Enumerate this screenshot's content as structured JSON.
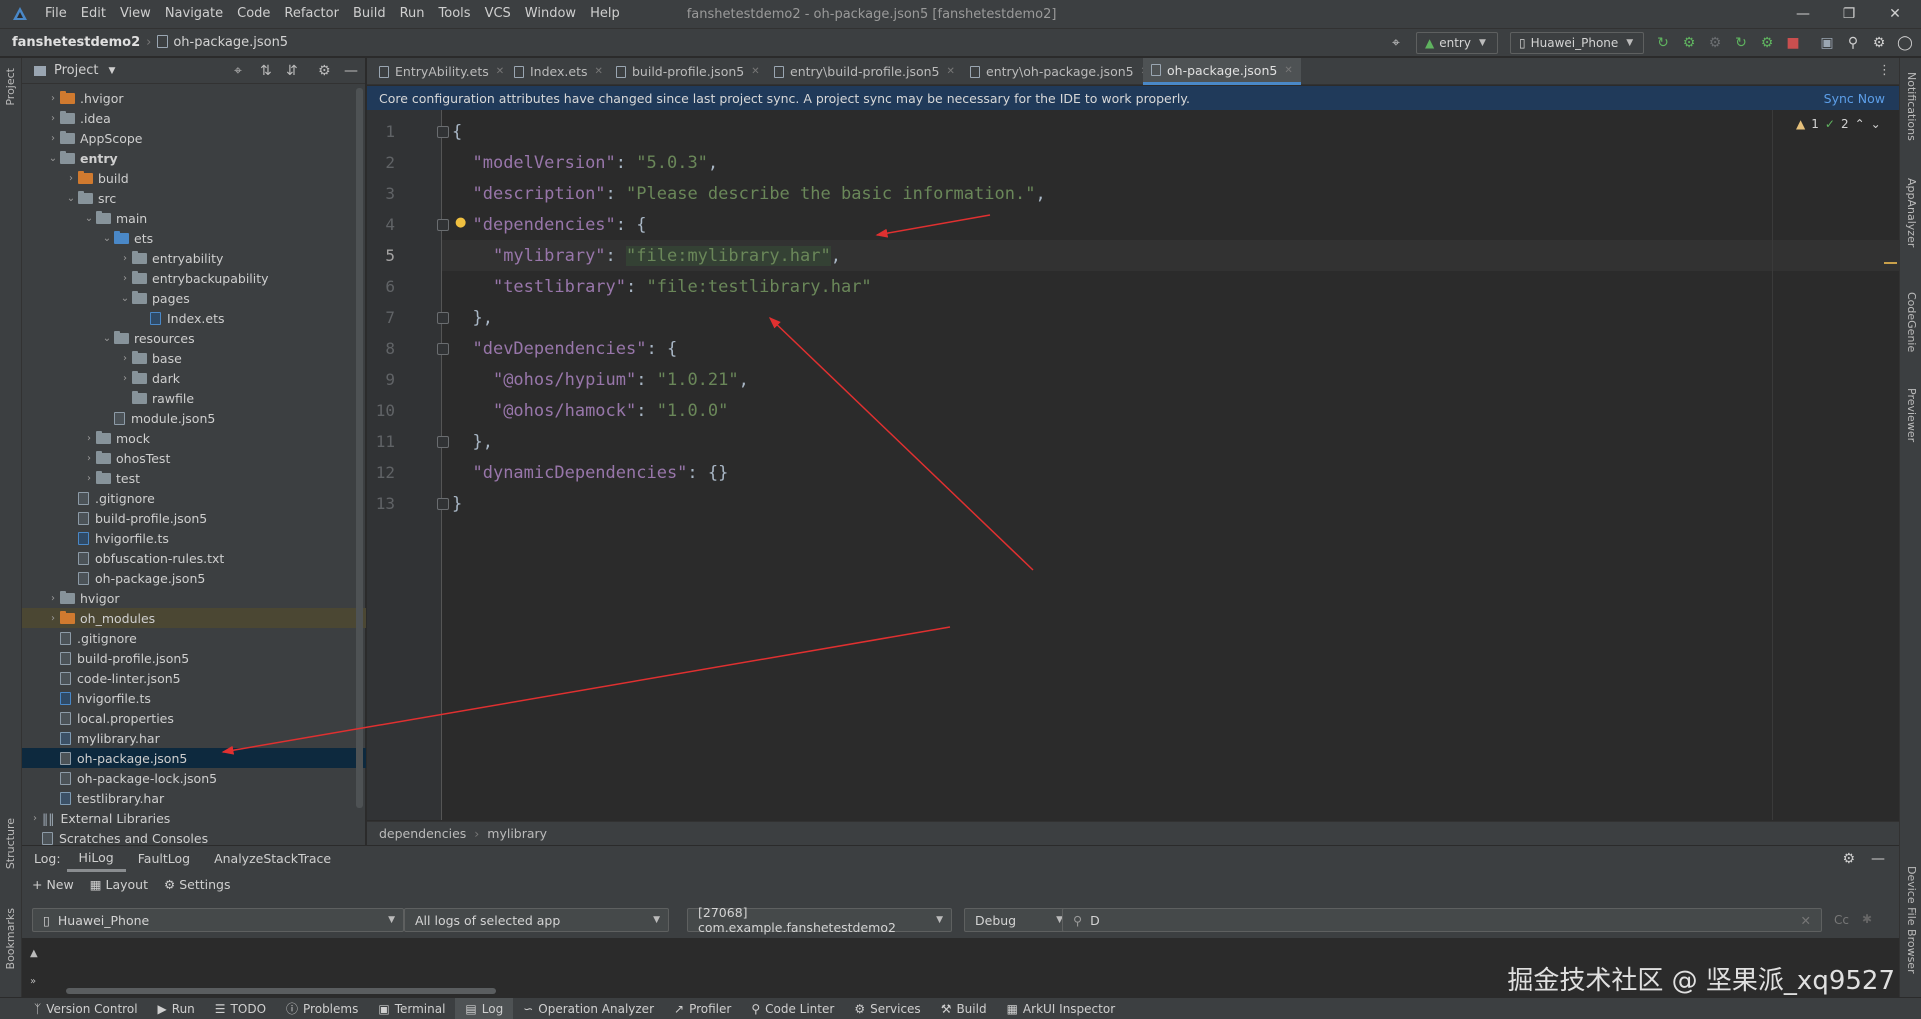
{
  "menubar": {
    "items": [
      "File",
      "Edit",
      "View",
      "Navigate",
      "Code",
      "Refactor",
      "Build",
      "Run",
      "Tools",
      "VCS",
      "Window",
      "Help"
    ],
    "window_title": "fanshetestdemo2 - oh-package.json5 [fanshetestdemo2]"
  },
  "navbar": {
    "project": "fanshetestdemo2",
    "file": "oh-package.json5",
    "run_config": "entry",
    "device": "Huawei_Phone"
  },
  "project_panel": {
    "title": "Project",
    "tree": [
      {
        "label": ".hvigor",
        "icon": "folder-orange",
        "chev": "›",
        "indent": 1
      },
      {
        "label": ".idea",
        "icon": "folder",
        "chev": "›",
        "indent": 1
      },
      {
        "label": "AppScope",
        "icon": "folder",
        "chev": "›",
        "indent": 1
      },
      {
        "label": "entry",
        "icon": "folder",
        "chev": "⌄",
        "indent": 1,
        "bold": true
      },
      {
        "label": "build",
        "icon": "folder-orange",
        "chev": "›",
        "indent": 2
      },
      {
        "label": "src",
        "icon": "folder",
        "chev": "⌄",
        "indent": 2
      },
      {
        "label": "main",
        "icon": "folder",
        "chev": "⌄",
        "indent": 3
      },
      {
        "label": "ets",
        "icon": "folder-blue",
        "chev": "⌄",
        "indent": 4
      },
      {
        "label": "entryability",
        "icon": "folder",
        "chev": "›",
        "indent": 5
      },
      {
        "label": "entrybackupability",
        "icon": "folder",
        "chev": "›",
        "indent": 5
      },
      {
        "label": "pages",
        "icon": "folder",
        "chev": "⌄",
        "indent": 5
      },
      {
        "label": "Index.ets",
        "icon": "file-ts",
        "chev": "",
        "indent": 6
      },
      {
        "label": "resources",
        "icon": "folder",
        "chev": "⌄",
        "indent": 4
      },
      {
        "label": "base",
        "icon": "folder",
        "chev": "›",
        "indent": 5
      },
      {
        "label": "dark",
        "icon": "folder",
        "chev": "›",
        "indent": 5
      },
      {
        "label": "rawfile",
        "icon": "folder",
        "chev": "",
        "indent": 5
      },
      {
        "label": "module.json5",
        "icon": "file",
        "chev": "",
        "indent": 4
      },
      {
        "label": "mock",
        "icon": "folder",
        "chev": "›",
        "indent": 3
      },
      {
        "label": "ohosTest",
        "icon": "folder",
        "chev": "›",
        "indent": 3
      },
      {
        "label": "test",
        "icon": "folder",
        "chev": "›",
        "indent": 3
      },
      {
        "label": ".gitignore",
        "icon": "file",
        "chev": "",
        "indent": 2
      },
      {
        "label": "build-profile.json5",
        "icon": "file",
        "chev": "",
        "indent": 2
      },
      {
        "label": "hvigorfile.ts",
        "icon": "file-ts",
        "chev": "",
        "indent": 2
      },
      {
        "label": "obfuscation-rules.txt",
        "icon": "file",
        "chev": "",
        "indent": 2
      },
      {
        "label": "oh-package.json5",
        "icon": "file",
        "chev": "",
        "indent": 2
      },
      {
        "label": "hvigor",
        "icon": "folder",
        "chev": "›",
        "indent": 1
      },
      {
        "label": "oh_modules",
        "icon": "folder-orange",
        "chev": "›",
        "indent": 1,
        "excluded": true
      },
      {
        "label": ".gitignore",
        "icon": "file",
        "chev": "",
        "indent": 1
      },
      {
        "label": "build-profile.json5",
        "icon": "file",
        "chev": "",
        "indent": 1
      },
      {
        "label": "code-linter.json5",
        "icon": "file",
        "chev": "",
        "indent": 1
      },
      {
        "label": "hvigorfile.ts",
        "icon": "file-ts",
        "chev": "",
        "indent": 1
      },
      {
        "label": "local.properties",
        "icon": "file",
        "chev": "",
        "indent": 1
      },
      {
        "label": "mylibrary.har",
        "icon": "file-har",
        "chev": "",
        "indent": 1
      },
      {
        "label": "oh-package.json5",
        "icon": "file",
        "chev": "",
        "indent": 1,
        "selected": true
      },
      {
        "label": "oh-package-lock.json5",
        "icon": "file",
        "chev": "",
        "indent": 1
      },
      {
        "label": "testlibrary.har",
        "icon": "file-har",
        "chev": "",
        "indent": 1
      },
      {
        "label": "External Libraries",
        "icon": "lib",
        "chev": "›",
        "indent": 0
      },
      {
        "label": "Scratches and Consoles",
        "icon": "scratch",
        "chev": "",
        "indent": 0
      }
    ]
  },
  "tabs": [
    {
      "label": "EntryAbility.ets",
      "active": false
    },
    {
      "label": "Index.ets",
      "active": false
    },
    {
      "label": "build-profile.json5",
      "active": false
    },
    {
      "label": "entry\\build-profile.json5",
      "active": false
    },
    {
      "label": "entry\\oh-package.json5",
      "active": false
    },
    {
      "label": "oh-package.json5",
      "active": true
    }
  ],
  "banner": {
    "message": "Core configuration attributes have changed since last project sync. A project sync may be necessary for the IDE to work properly.",
    "action": "Sync Now"
  },
  "inspection": {
    "warnings": "1",
    "ok": "2"
  },
  "editor": {
    "current_line": 5,
    "lines": [
      {
        "n": "1",
        "t": "{"
      },
      {
        "n": "2",
        "t": "  \"modelVersion\": \"5.0.3\","
      },
      {
        "n": "3",
        "t": "  \"description\": \"Please describe the basic information.\","
      },
      {
        "n": "4",
        "t": "  \"dependencies\": {"
      },
      {
        "n": "5",
        "t": "    \"mylibrary\": \"file:mylibrary.har\","
      },
      {
        "n": "6",
        "t": "    \"testlibrary\": \"file:testlibrary.har\""
      },
      {
        "n": "7",
        "t": "  },"
      },
      {
        "n": "8",
        "t": "  \"devDependencies\": {"
      },
      {
        "n": "9",
        "t": "    \"@ohos/hypium\": \"1.0.21\","
      },
      {
        "n": "10",
        "t": "    \"@ohos/hamock\": \"1.0.0\""
      },
      {
        "n": "11",
        "t": "  },"
      },
      {
        "n": "12",
        "t": "  \"dynamicDependencies\": {}"
      },
      {
        "n": "13",
        "t": "}"
      }
    ]
  },
  "editor_breadcrumb": [
    "dependencies",
    "mylibrary"
  ],
  "log_panel": {
    "label": "Log:",
    "tabs": [
      "HiLog",
      "FaultLog",
      "AnalyzeStackTrace"
    ],
    "tools": [
      "New",
      "Layout",
      "Settings"
    ],
    "device": "Huawei_Phone",
    "filter": "All logs of selected app",
    "process": "[27068] com.example.fanshetestdemo2",
    "level": "Debug",
    "search_value": "D",
    "cc": "Cc"
  },
  "side_labels": {
    "left": [
      "Project",
      "Structure",
      "Bookmarks"
    ],
    "right": [
      "Notifications",
      "AppAnalyzer",
      "CodeGenie",
      "Previewer",
      "Device File Browser"
    ]
  },
  "statusbar": {
    "items": [
      "Version Control",
      "Run",
      "TODO",
      "Problems",
      "Terminal",
      "Log",
      "Operation Analyzer",
      "Profiler",
      "Code Linter",
      "Services",
      "Build",
      "ArkUI Inspector"
    ]
  },
  "watermark": "掘金技术社区 @ 坚果派_xq9527"
}
